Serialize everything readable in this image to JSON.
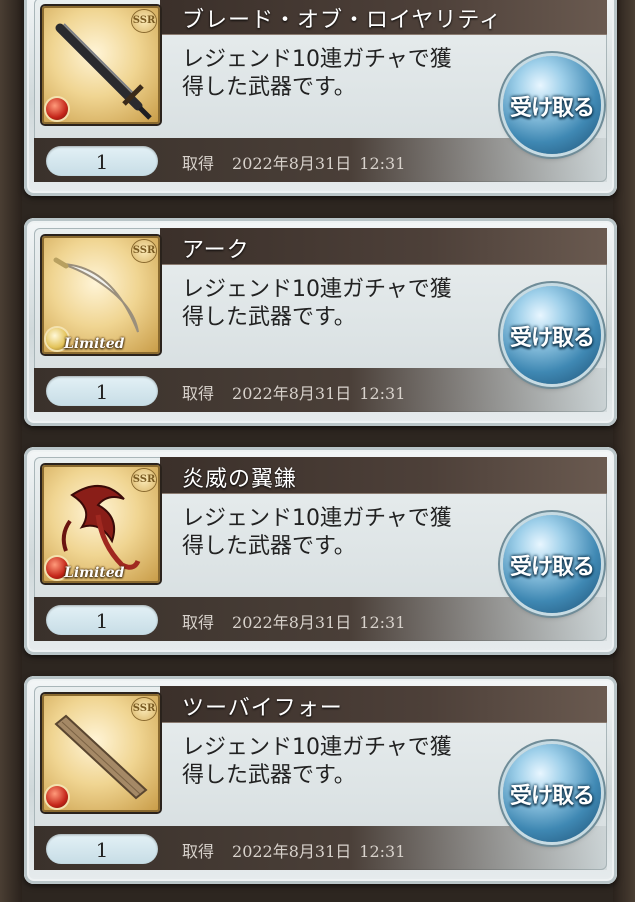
{
  "items": [
    {
      "name": "ブレード・オブ・ロイヤリティ",
      "desc_line1": "レジェンド10連ガチャで獲",
      "desc_line2": "得した武器です。",
      "quantity": "1",
      "obtained_label": "取得",
      "date": "2022年8月31日",
      "time": "12:31",
      "rarity": "SSR",
      "element": "fire",
      "limited": "",
      "weapon_icon": "sword-icon",
      "receive_label": "受け取る"
    },
    {
      "name": "アーク",
      "desc_line1": "レジェンド10連ガチャで獲",
      "desc_line2": "得した武器です。",
      "quantity": "1",
      "obtained_label": "取得",
      "date": "2022年8月31日",
      "time": "12:31",
      "rarity": "SSR",
      "element": "light",
      "limited": "Limited",
      "weapon_icon": "curved-blade-icon",
      "receive_label": "受け取る"
    },
    {
      "name": "炎威の翼鎌",
      "desc_line1": "レジェンド10連ガチャで獲",
      "desc_line2": "得した武器です。",
      "quantity": "1",
      "obtained_label": "取得",
      "date": "2022年8月31日",
      "time": "12:31",
      "rarity": "SSR",
      "element": "fire",
      "limited": "Limited",
      "weapon_icon": "winged-scythe-icon",
      "receive_label": "受け取る"
    },
    {
      "name": "ツーバイフォー",
      "desc_line1": "レジェンド10連ガチャで獲",
      "desc_line2": "得した武器です。",
      "quantity": "1",
      "obtained_label": "取得",
      "date": "2022年8月31日",
      "time": "12:31",
      "rarity": "SSR",
      "element": "fire",
      "limited": "",
      "weapon_icon": "wooden-plank-icon",
      "receive_label": "受け取る"
    }
  ]
}
